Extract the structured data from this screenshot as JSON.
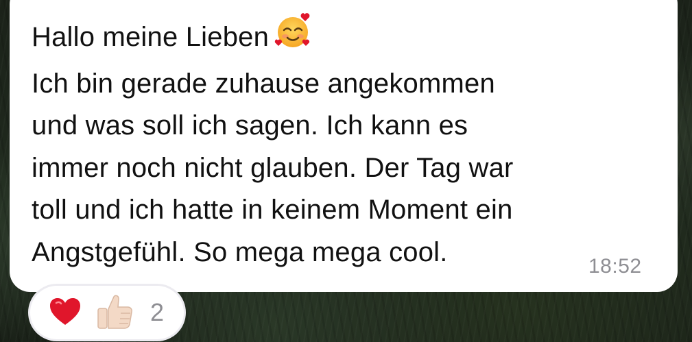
{
  "wallpaper": {
    "description": "dark forest"
  },
  "message": {
    "lines": [
      "Hallo meine Lieben",
      "Ich bin gerade zuhause angekommen",
      "und was soll ich sagen. Ich kann es",
      "immer noch nicht glauben. Der Tag war",
      "toll und ich hatte in keinem Moment ein",
      "Angstgefühl. So mega mega cool."
    ],
    "title_emoji": "smiling-face-with-hearts",
    "timestamp": "18:52"
  },
  "reactions": {
    "items": [
      {
        "icon": "red-heart-icon"
      },
      {
        "icon": "thumbs-up-icon",
        "skin_tone": "#f3d9c6"
      }
    ],
    "count": "2"
  },
  "colors": {
    "bubble": "#ffffff",
    "text": "#111111",
    "timestamp": "#8e8e93",
    "sender_accent": "#22a34a",
    "heart": "#e0162b"
  }
}
